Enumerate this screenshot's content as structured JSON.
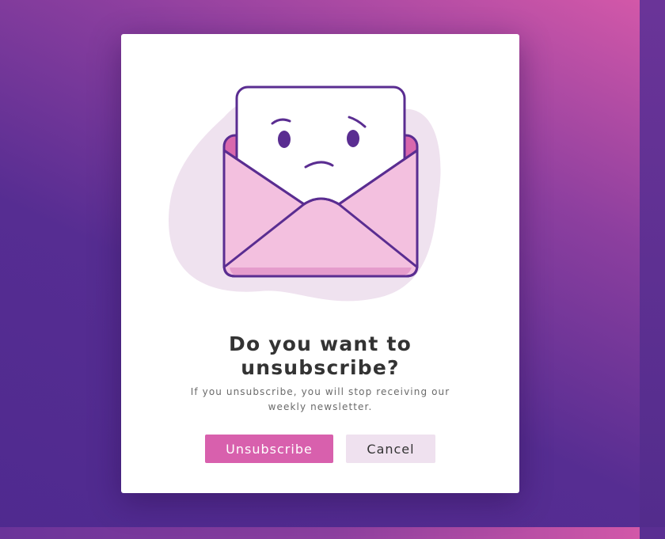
{
  "dialog": {
    "title_line1": "Do you want to",
    "title_line2": "unsubscribe?",
    "description": "If you unsubscribe, you will stop receiving our weekly newsletter.",
    "primary_button": "Unsubscribe",
    "secondary_button": "Cancel"
  },
  "icons": {
    "illustration": "sad-envelope-icon"
  },
  "colors": {
    "primary": "#d860ad",
    "secondary_bg": "#efe1ef",
    "outline": "#5a2d91",
    "envelope_fill": "#f3c0df",
    "blob": "#efe2ef"
  }
}
